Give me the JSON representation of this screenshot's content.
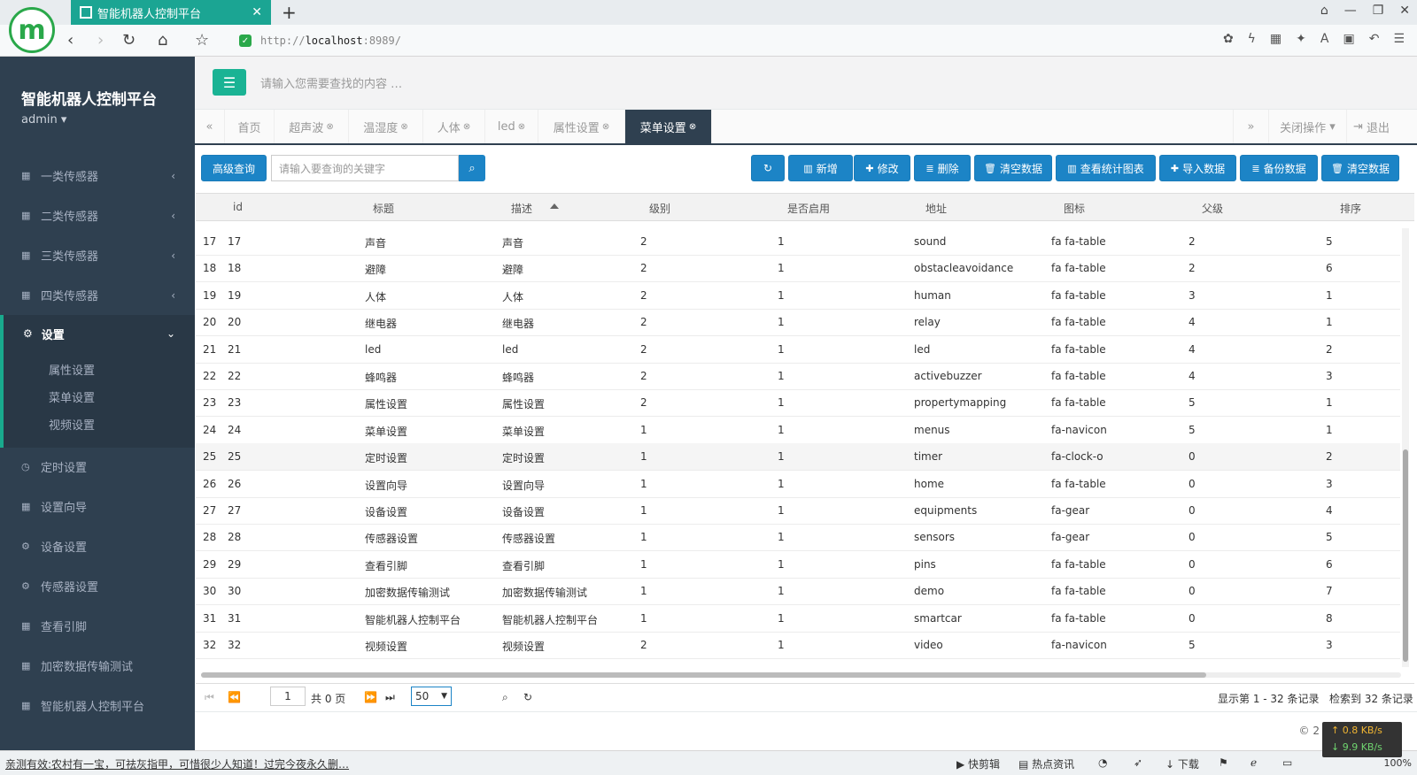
{
  "browser": {
    "tab_title": "智能机器人控制平台",
    "url_scheme": "http://",
    "url_host": "localhost",
    "url_rest": ":8989/"
  },
  "app": {
    "brand": "智能机器人控制平台",
    "user": "admin",
    "search_placeholder": "请输入您需要查找的内容 …"
  },
  "sidebar": {
    "items_top": [
      {
        "label": "一类传感器",
        "icon": "table-icon"
      },
      {
        "label": "二类传感器",
        "icon": "table-icon"
      },
      {
        "label": "三类传感器",
        "icon": "table-icon"
      },
      {
        "label": "四类传感器",
        "icon": "table-icon"
      }
    ],
    "open_group": {
      "label": "设置",
      "icon": "gears-icon"
    },
    "sub_items": [
      "属性设置",
      "菜单设置",
      "视频设置"
    ],
    "items_bottom": [
      {
        "label": "定时设置",
        "icon": "clock-icon"
      },
      {
        "label": "设置向导",
        "icon": "table-icon"
      },
      {
        "label": "设备设置",
        "icon": "gear-icon"
      },
      {
        "label": "传感器设置",
        "icon": "gear-icon"
      },
      {
        "label": "查看引脚",
        "icon": "table-icon"
      },
      {
        "label": "加密数据传输测试",
        "icon": "table-icon"
      },
      {
        "label": "智能机器人控制平台",
        "icon": "table-icon"
      }
    ]
  },
  "page_tabs": {
    "items": [
      "首页",
      "超声波",
      "温湿度",
      "人体",
      "led",
      "属性设置",
      "菜单设置"
    ],
    "close_ops": "关闭操作",
    "logout": "退出"
  },
  "toolbar": {
    "advanced_search": "高级查询",
    "keyword_placeholder": "请输入要查询的关键字",
    "buttons": [
      "新增",
      "修改",
      "删除",
      "清空数据",
      "查看统计图表",
      "导入数据",
      "备份数据",
      "清空数据"
    ]
  },
  "table": {
    "columns": [
      "id",
      "标题",
      "描述",
      "级别",
      "是否启用",
      "地址",
      "图标",
      "父级",
      "排序"
    ],
    "rows": [
      [
        "17",
        "17",
        "声音",
        "声音",
        "2",
        "1",
        "sound",
        "fa fa-table",
        "2",
        "5"
      ],
      [
        "18",
        "18",
        "避障",
        "避障",
        "2",
        "1",
        "obstacleavoidance",
        "fa fa-table",
        "2",
        "6"
      ],
      [
        "19",
        "19",
        "人体",
        "人体",
        "2",
        "1",
        "human",
        "fa fa-table",
        "3",
        "1"
      ],
      [
        "20",
        "20",
        "继电器",
        "继电器",
        "2",
        "1",
        "relay",
        "fa fa-table",
        "4",
        "1"
      ],
      [
        "21",
        "21",
        "led",
        "led",
        "2",
        "1",
        "led",
        "fa fa-table",
        "4",
        "2"
      ],
      [
        "22",
        "22",
        "蜂鸣器",
        "蜂鸣器",
        "2",
        "1",
        "activebuzzer",
        "fa fa-table",
        "4",
        "3"
      ],
      [
        "23",
        "23",
        "属性设置",
        "属性设置",
        "2",
        "1",
        "propertymapping",
        "fa fa-table",
        "5",
        "1"
      ],
      [
        "24",
        "24",
        "菜单设置",
        "菜单设置",
        "1",
        "1",
        "menus",
        "fa-navicon",
        "5",
        "1"
      ],
      [
        "25",
        "25",
        "定时设置",
        "定时设置",
        "1",
        "1",
        "timer",
        "fa-clock-o",
        "0",
        "2"
      ],
      [
        "26",
        "26",
        "设置向导",
        "设置向导",
        "1",
        "1",
        "home",
        "fa fa-table",
        "0",
        "3"
      ],
      [
        "27",
        "27",
        "设备设置",
        "设备设置",
        "1",
        "1",
        "equipments",
        "fa-gear",
        "0",
        "4"
      ],
      [
        "28",
        "28",
        "传感器设置",
        "传感器设置",
        "1",
        "1",
        "sensors",
        "fa-gear",
        "0",
        "5"
      ],
      [
        "29",
        "29",
        "查看引脚",
        "查看引脚",
        "1",
        "1",
        "pins",
        "fa fa-table",
        "0",
        "6"
      ],
      [
        "30",
        "30",
        "加密数据传输测试",
        "加密数据传输测试",
        "1",
        "1",
        "demo",
        "fa fa-table",
        "0",
        "7"
      ],
      [
        "31",
        "31",
        "智能机器人控制平台",
        "智能机器人控制平台",
        "1",
        "1",
        "smartcar",
        "fa fa-table",
        "0",
        "8"
      ],
      [
        "32",
        "32",
        "视频设置",
        "视频设置",
        "2",
        "1",
        "video",
        "fa-navicon",
        "5",
        "3"
      ]
    ]
  },
  "pager": {
    "page": "1",
    "total_pages": "共 0 页",
    "page_size": "50",
    "range_info": "显示第 1 - 32 条记录",
    "found_info": "检索到 32 条记录"
  },
  "footer": {
    "copyright": "© 2"
  },
  "speed": {
    "up": "↑ 0.8 KB/s",
    "down": "↓ 9.9 KB/s"
  },
  "statusbar": {
    "news": "亲测有效:农村有一宝，可祛灰指甲，可惜很少人知道！过完今夜永久删…",
    "items": [
      "快剪辑",
      "热点资讯",
      "下载"
    ],
    "zoom": "100%"
  }
}
